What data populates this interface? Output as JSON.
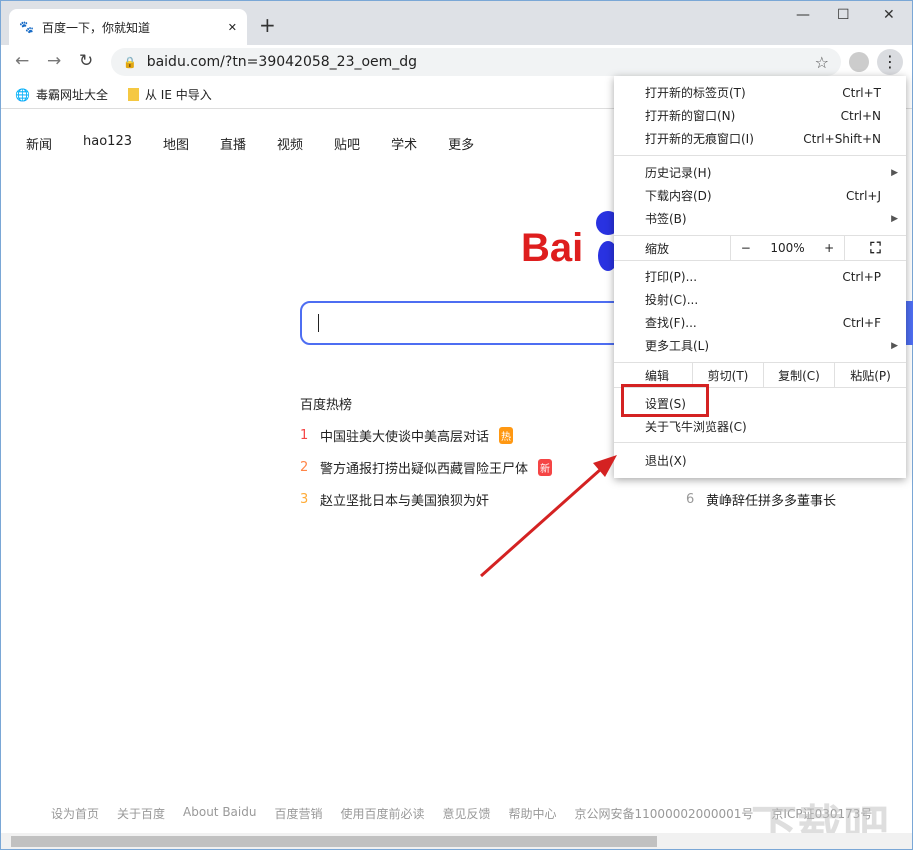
{
  "tab": {
    "title": "百度一下，你就知道",
    "close": "✕",
    "new_tab": "+"
  },
  "window": {
    "minimize": "—",
    "maximize": "☐",
    "close": "✕"
  },
  "address": {
    "url": "baidu.com/?tn=39042058_23_oem_dg"
  },
  "bookmarks": [
    {
      "label": "毒霸网址大全",
      "icon": "globe-icon"
    },
    {
      "label": "从 IE 中导入",
      "icon": "folder-icon"
    }
  ],
  "topnav": [
    "新闻",
    "hao123",
    "地图",
    "直播",
    "视频",
    "贴吧",
    "学术",
    "更多"
  ],
  "logo": "Bai",
  "hot": {
    "title": "百度热榜",
    "items": [
      {
        "rank": "1",
        "text": "中国驻美大使谈中美高层对话",
        "badge": "热",
        "color": "#f54545",
        "badge_color": "#ff9812"
      },
      {
        "rank": "2",
        "text": "警方通报打捞出疑似西藏冒险王尸体",
        "badge": "新",
        "color": "#ff8547",
        "badge_color": "#f54545"
      },
      {
        "rank": "3",
        "text": "赵立坚批日本与美国狼狈为奸",
        "badge": "",
        "color": "#ffac38"
      },
      {
        "rank": "6",
        "text": "黄峥辞任拼多多董事长",
        "badge": "",
        "color": "#999"
      }
    ]
  },
  "menu": {
    "items": [
      {
        "label": "打开新的标签页(T)",
        "shortcut": "Ctrl+T"
      },
      {
        "label": "打开新的窗口(N)",
        "shortcut": "Ctrl+N"
      },
      {
        "label": "打开新的无痕窗口(I)",
        "shortcut": "Ctrl+Shift+N"
      },
      {
        "label": "历史记录(H)",
        "shortcut": ""
      },
      {
        "label": "下载内容(D)",
        "shortcut": "Ctrl+J"
      },
      {
        "label": "书签(B)",
        "shortcut": ""
      },
      {
        "label": "打印(P)...",
        "shortcut": "Ctrl+P"
      },
      {
        "label": "投射(C)...",
        "shortcut": ""
      },
      {
        "label": "查找(F)...",
        "shortcut": "Ctrl+F"
      },
      {
        "label": "更多工具(L)",
        "shortcut": ""
      },
      {
        "label": "设置(S)",
        "shortcut": ""
      },
      {
        "label": "关于飞牛浏览器(C)",
        "shortcut": ""
      },
      {
        "label": "退出(X)",
        "shortcut": ""
      }
    ],
    "zoom": {
      "label": "缩放",
      "minus": "−",
      "value": "100%",
      "plus": "+"
    },
    "edit": {
      "label": "编辑",
      "cut": "剪切(T)",
      "copy": "复制(C)",
      "paste": "粘贴(P)"
    }
  },
  "footer": [
    "设为首页",
    "关于百度",
    "About Baidu",
    "百度营销",
    "使用百度前必读",
    "意见反馈",
    "帮助中心",
    "京公网安备11000002000001号",
    "京ICP证030173号"
  ],
  "watermark": "下载吧"
}
